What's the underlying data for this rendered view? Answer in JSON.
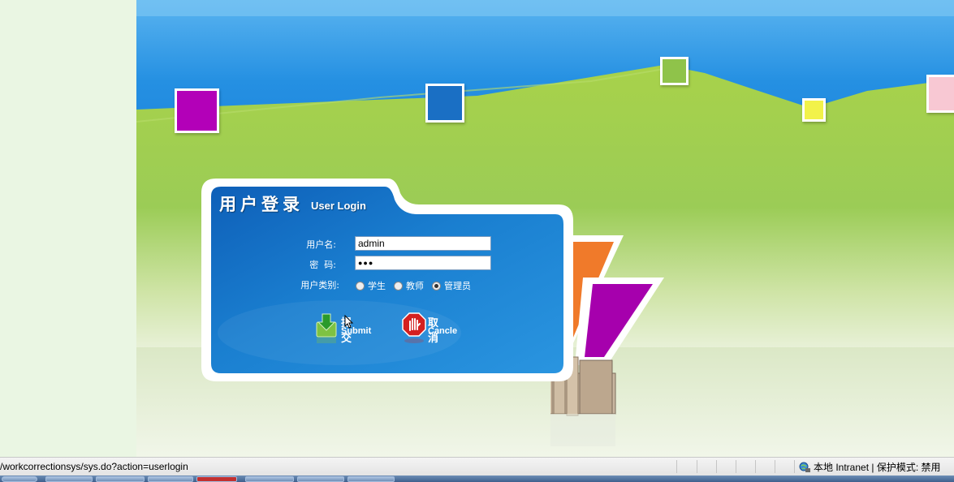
{
  "login": {
    "title_cn": "用户登录",
    "title_en": "User Login",
    "username_label": "用户名:",
    "username_value": "admin",
    "password_label": "密  码:",
    "password_value": "●●●",
    "usertype_label": "用户类别:",
    "usertype_options": [
      "学生",
      "教师",
      "管理员"
    ],
    "usertype_selected": "管理员",
    "submit_cn": "提 交",
    "submit_en": "Submit",
    "cancel_cn": "取 消",
    "cancel_en": "Cancle"
  },
  "statusbar": {
    "url": "/workcorrectionsys/sys.do?action=userlogin",
    "zone": "本地 Intranet | 保护模式: 禁用"
  },
  "colors": {
    "sky": "#2a8fe0",
    "grass": "#8dc63f",
    "card_blue": "#1f86d6",
    "square_purple": "#b300b8",
    "square_blue": "#1a6fc4",
    "square_green": "#8fc34a",
    "square_yellow": "#f2f24a",
    "square_pink": "#f8c8d3"
  }
}
